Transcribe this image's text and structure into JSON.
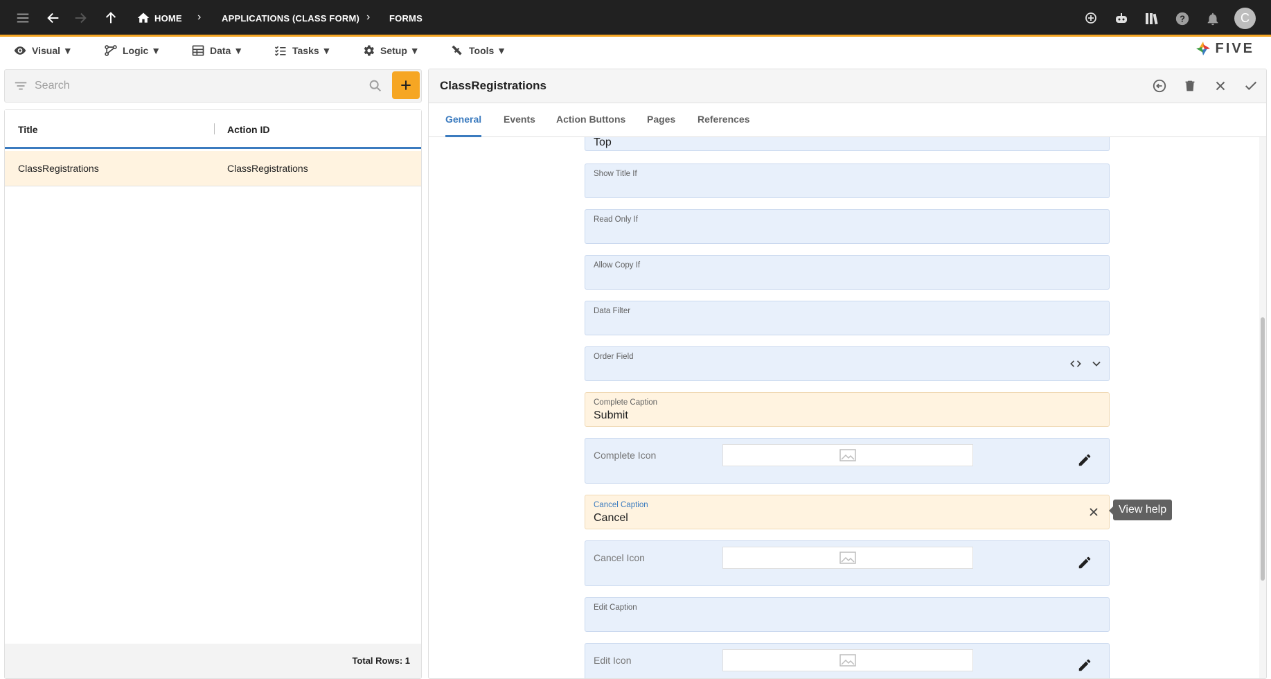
{
  "topbar": {
    "breadcrumbs": [
      "HOME",
      "APPLICATIONS (CLASS FORM)",
      "FORMS"
    ],
    "avatar_initial": "C"
  },
  "menubar": {
    "items": [
      "Visual ▼",
      "Logic ▼",
      "Data ▼",
      "Tasks ▼",
      "Setup ▼",
      "Tools ▼"
    ],
    "logo": "FIVE"
  },
  "list": {
    "search_placeholder": "Search",
    "columns": [
      "Title",
      "Action ID"
    ],
    "rows": [
      {
        "title": "ClassRegistrations",
        "action_id": "ClassRegistrations"
      }
    ],
    "footer": "Total Rows: 1"
  },
  "form": {
    "title": "ClassRegistrations",
    "tabs": [
      "General",
      "Events",
      "Action Buttons",
      "Pages",
      "References"
    ],
    "active_tab": "General",
    "fields": {
      "top_value": "Top",
      "show_title_if": {
        "label": "Show Title If",
        "value": ""
      },
      "read_only_if": {
        "label": "Read Only If",
        "value": ""
      },
      "allow_copy_if": {
        "label": "Allow Copy If",
        "value": ""
      },
      "data_filter": {
        "label": "Data Filter",
        "value": ""
      },
      "order_field": {
        "label": "Order Field",
        "value": ""
      },
      "complete_caption": {
        "label": "Complete Caption",
        "value": "Submit"
      },
      "complete_icon": {
        "label": "Complete Icon"
      },
      "cancel_caption": {
        "label": "Cancel Caption",
        "value": "Cancel"
      },
      "cancel_icon": {
        "label": "Cancel Icon"
      },
      "edit_caption": {
        "label": "Edit Caption",
        "value": ""
      },
      "edit_icon": {
        "label": "Edit Icon"
      }
    },
    "tooltip": "View help"
  },
  "colors": {
    "accent": "#f6a623",
    "primary": "#3b7bbf",
    "topbar": "#212121"
  }
}
